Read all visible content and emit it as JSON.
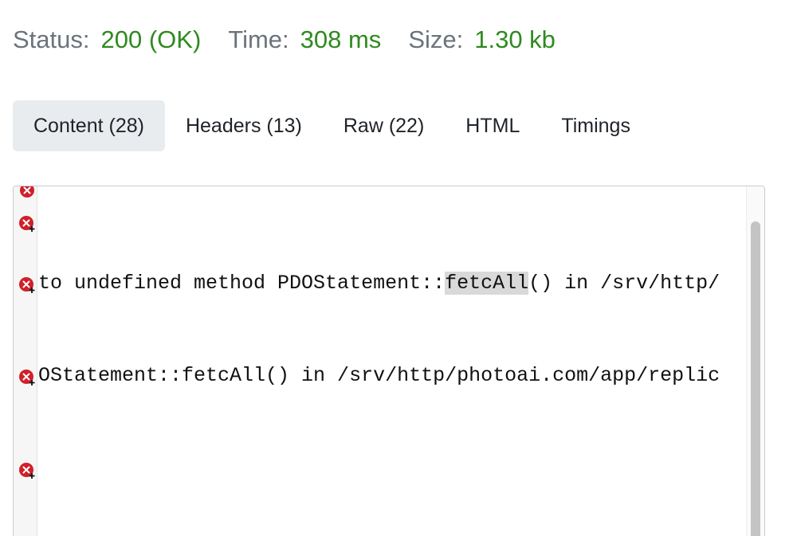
{
  "status_bar": {
    "status_label": "Status:",
    "status_value": "200 (OK)",
    "time_label": "Time:",
    "time_value": "308 ms",
    "size_label": "Size:",
    "size_value": "1.30 kb",
    "value_color": "#2f8a1f",
    "label_color": "#6b737c"
  },
  "tabs": [
    {
      "label": "Content (28)",
      "active": true
    },
    {
      "label": "Headers (13)",
      "active": false
    },
    {
      "label": "Raw (22)",
      "active": false
    },
    {
      "label": "HTML",
      "active": false
    },
    {
      "label": "Timings",
      "active": false
    }
  ],
  "editor": {
    "gutter_icons": [
      "error-icon",
      "error-fold-icon",
      "error-fold-icon",
      "error-fold-icon",
      "error-fold-icon"
    ],
    "error_color": "#d0202a",
    "lines": [
      {
        "before": "to undefined method PDOStatement::",
        "highlight": "fetcAll",
        "after": "() in /srv/http/"
      },
      {
        "before": "OStatement::fetcAll() in /srv/http/photoai.com/app/replic",
        "highlight": "",
        "after": ""
      }
    ]
  }
}
